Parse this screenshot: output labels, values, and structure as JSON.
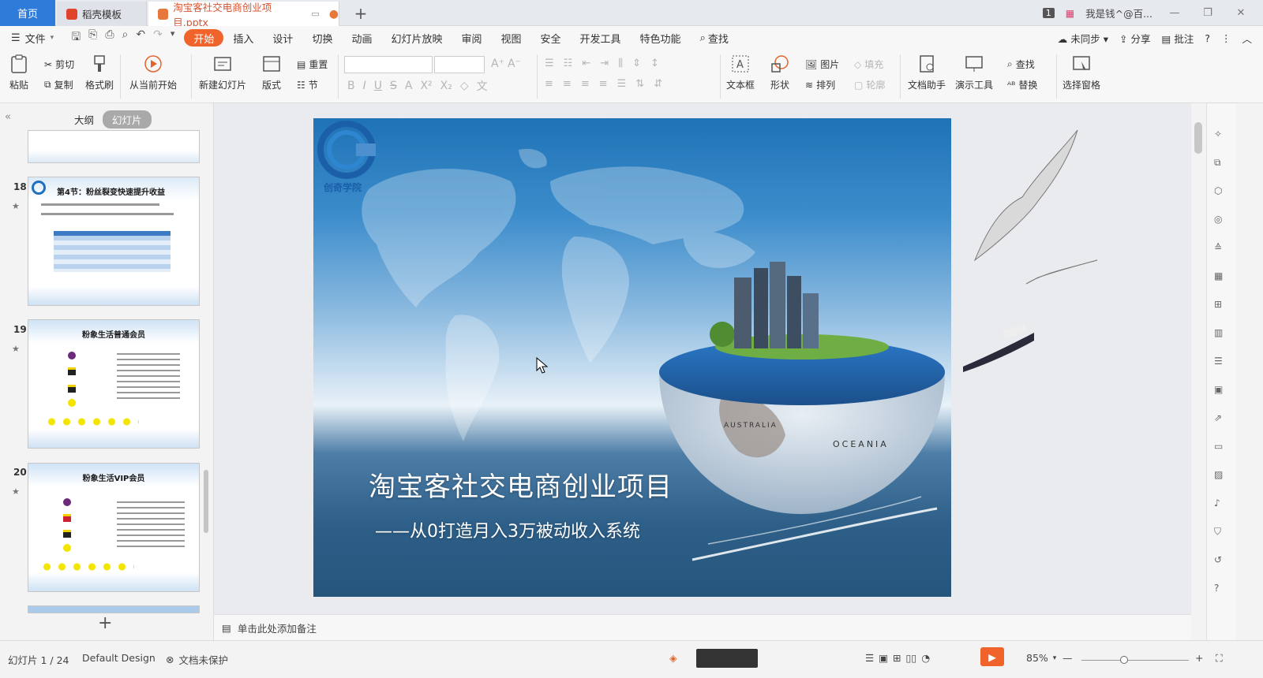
{
  "tabs": {
    "home": "首页",
    "template": "稻壳模板",
    "document": "淘宝客社交电商创业项目.pptx"
  },
  "window": {
    "badge": "1",
    "user": "我是钱^@百..."
  },
  "menu": {
    "file": "文件",
    "items": [
      "开始",
      "插入",
      "设计",
      "切换",
      "动画",
      "幻灯片放映",
      "审阅",
      "视图",
      "安全",
      "开发工具",
      "特色功能"
    ],
    "search": "查找",
    "sync": "未同步",
    "share": "分享",
    "comment": "批注"
  },
  "ribbon": {
    "paste": "粘贴",
    "cut": "剪切",
    "copy": "复制",
    "format_painter": "格式刷",
    "from_current": "从当前开始",
    "new_slide": "新建幻灯片",
    "layout": "版式",
    "reset": "重置",
    "section": "节",
    "textbox": "文本框",
    "shape": "形状",
    "picture": "图片",
    "fill": "填充",
    "arrange": "排列",
    "outline": "轮廓",
    "doc_assistant": "文档助手",
    "present_tools": "演示工具",
    "find": "查找",
    "replace": "替换",
    "select_pane": "选择窗格"
  },
  "left_panel": {
    "tab_outline": "大纲",
    "tab_slides": "幻灯片",
    "slides": [
      {
        "num": "18",
        "title": "第4节：粉丝裂变快速提升收益"
      },
      {
        "num": "19",
        "title": "粉象生活普通会员"
      },
      {
        "num": "20",
        "title": "粉象生活VIP会员"
      }
    ]
  },
  "slide": {
    "logo_text": "创奇学院",
    "title": "淘宝客社交电商创业项目",
    "subtitle": "——从0打造月入3万被动收入系统"
  },
  "notes": {
    "placeholder": "单击此处添加备注"
  },
  "status": {
    "slide_count": "幻灯片 1 / 24",
    "design": "Default Design",
    "protect": "文档未保护",
    "zoom": "85%"
  },
  "colors": {
    "accent": "#f0642c",
    "home_tab": "#2f7bd9"
  }
}
